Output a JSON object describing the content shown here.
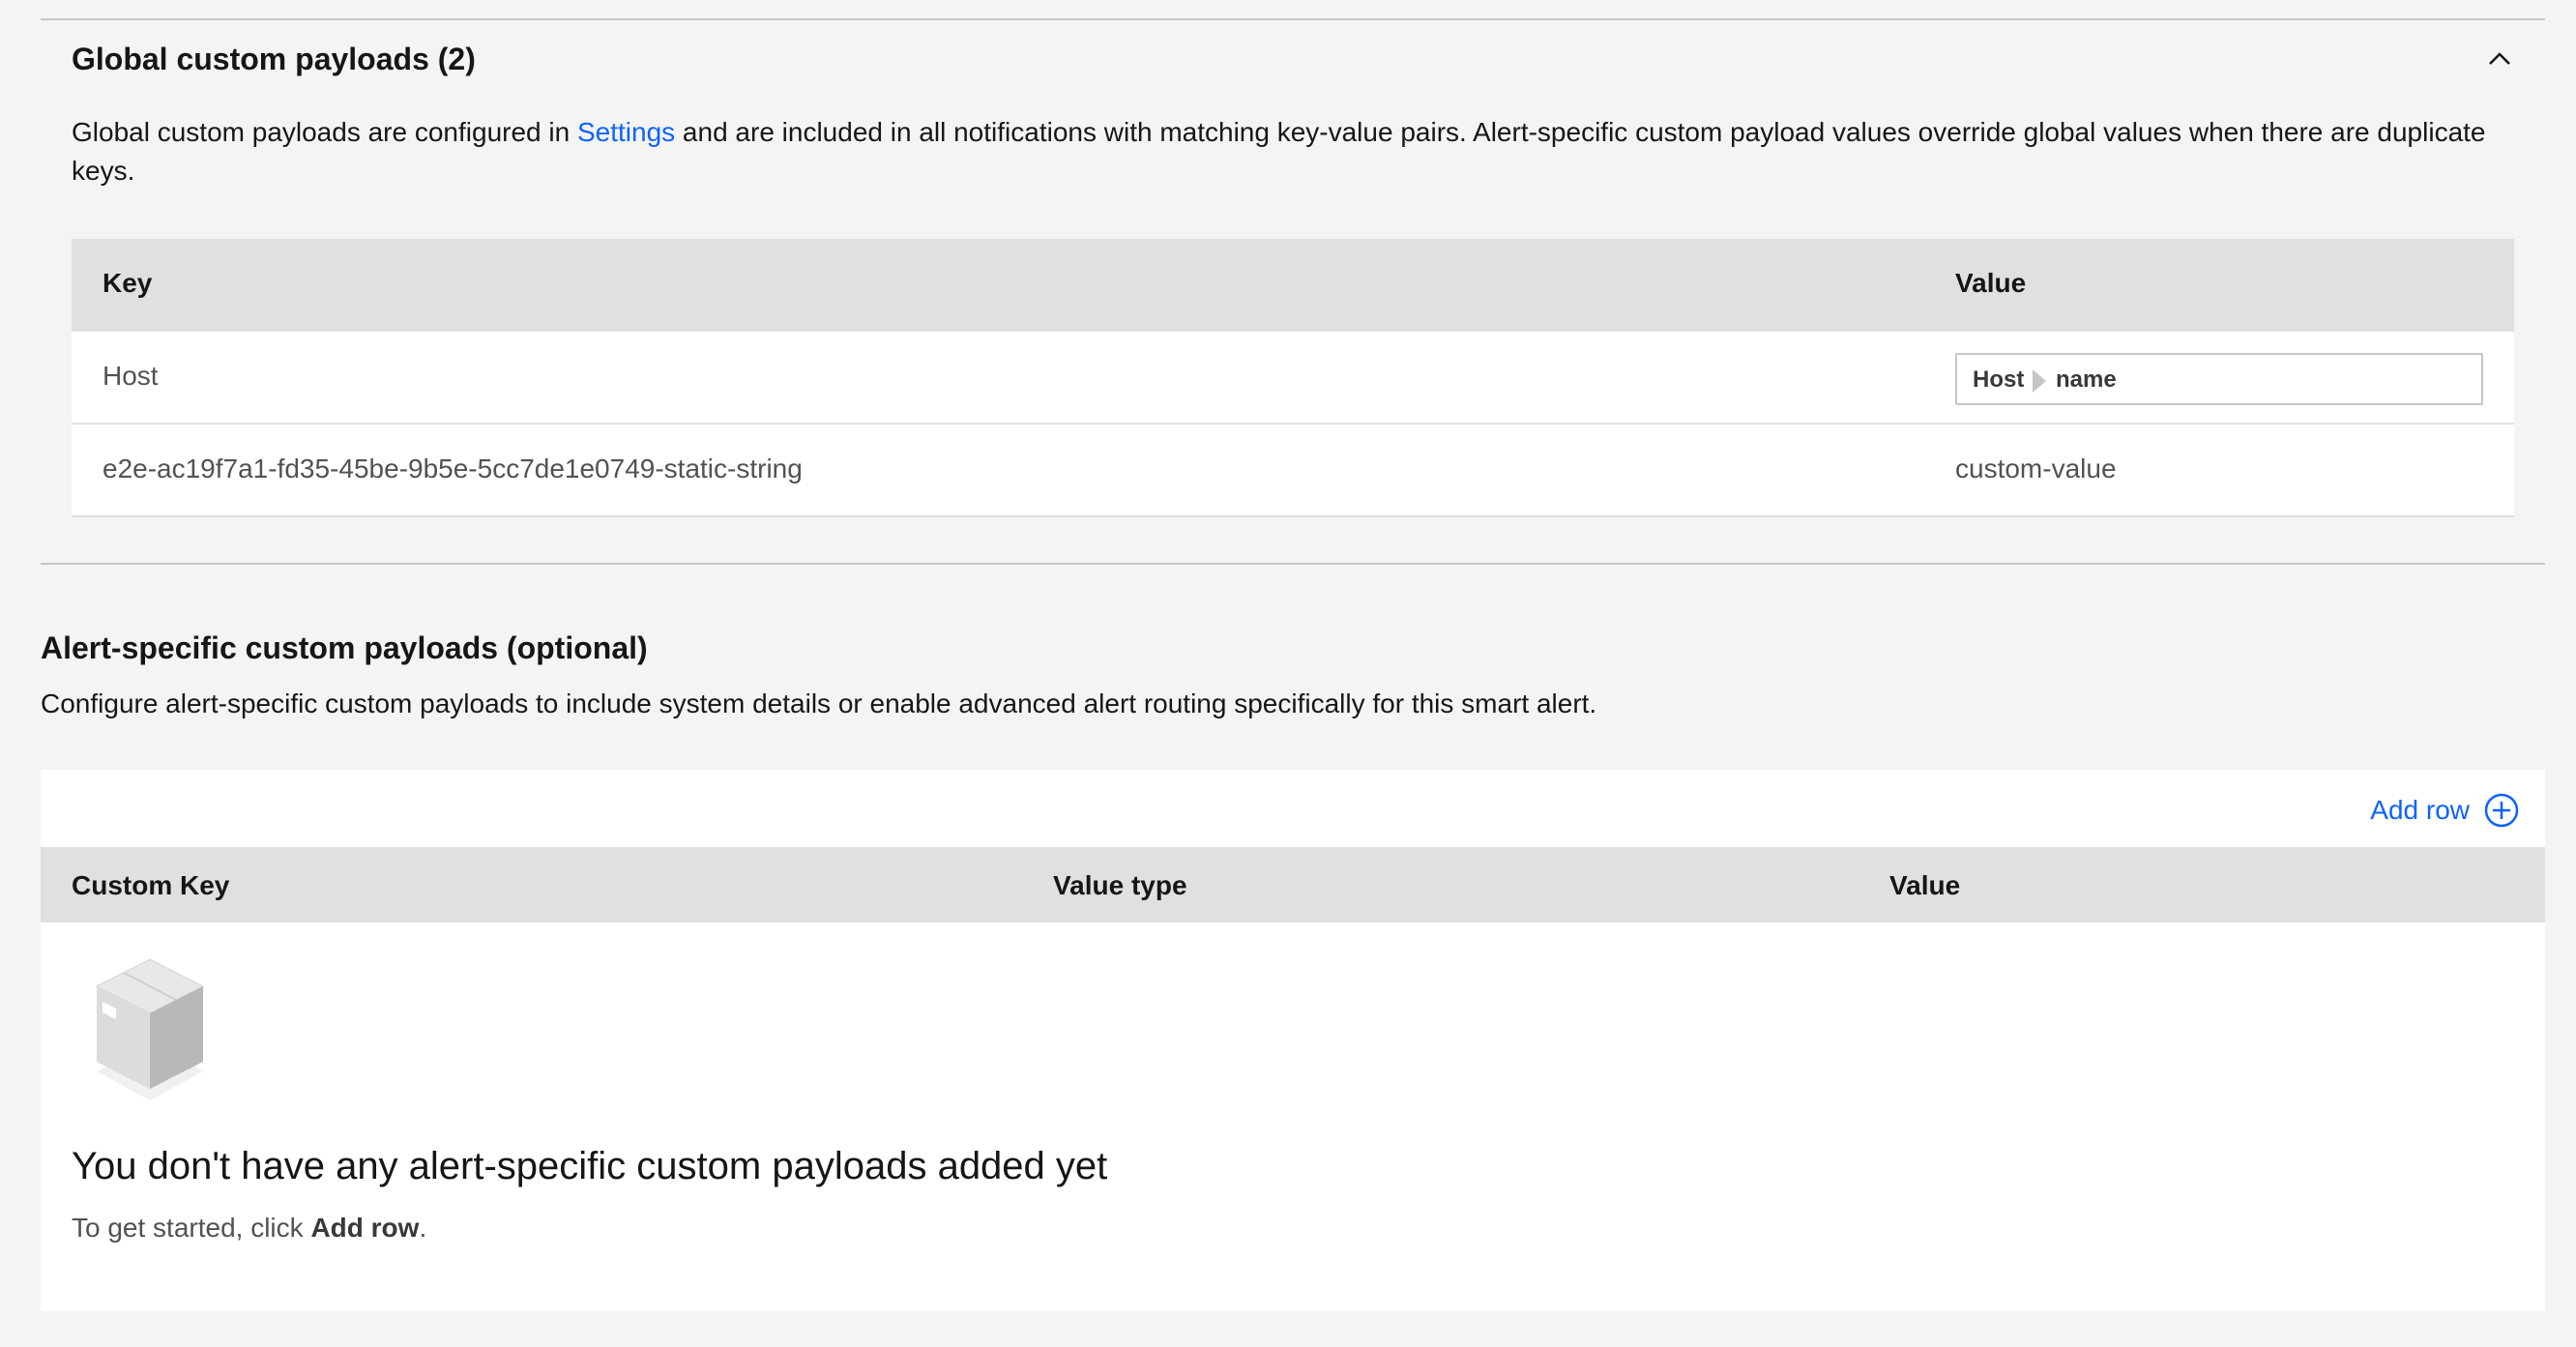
{
  "global": {
    "title": "Global custom payloads (2)",
    "desc_before": "Global custom payloads are configured in ",
    "desc_link": "Settings",
    "desc_after": " and are included in all notifications with matching key-value pairs. Alert-specific custom payload values override global values when there are du­plicate keys.",
    "columns": {
      "key": "Key",
      "value": "Value"
    },
    "rows": [
      {
        "key": "Host",
        "value_segments": [
          "Host",
          "name"
        ]
      },
      {
        "key": "e2e-ac19f7a1-fd35-45be-9b5e-5cc7de1e0749-static-string",
        "value": "custom-value"
      }
    ]
  },
  "alert": {
    "title": "Alert-specific custom payloads (optional)",
    "desc": "Configure alert-specific custom payloads to include system details or enable advanced alert routing specifically for this smart alert.",
    "add_row_label": "Add row",
    "columns": {
      "custom_key": "Custom Key",
      "value_type": "Value type",
      "value": "Value"
    },
    "empty_title": "You don't have any alert-specific custom payloads added yet",
    "empty_sub_before": "To get started, click ",
    "empty_sub_bold": "Add row",
    "empty_sub_after": "."
  },
  "icons": {
    "collapse": "chevron-up-icon",
    "add": "add-circle-icon",
    "empty": "box-icon"
  },
  "colors": {
    "link": "#0f62fe",
    "header_bg": "#e0e0e0",
    "page_bg": "#f4f4f4"
  }
}
